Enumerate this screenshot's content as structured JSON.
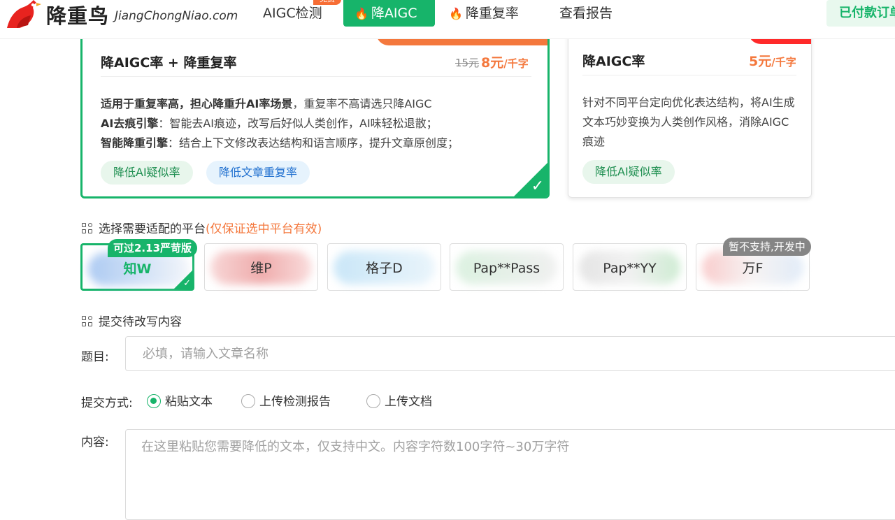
{
  "brand": {
    "name_cn": "降重鸟",
    "name_en": "JiangChongNiao.com"
  },
  "nav": {
    "aigc_detect": "AIGC检测",
    "free_badge": "免费",
    "reduce_aigc": "降AIGC",
    "reduce_dup": "降重复率",
    "view_report": "查看报告",
    "paid_order": "已付款订单"
  },
  "icons": {
    "flame": "🔥",
    "check": "✓"
  },
  "colors": {
    "accent": "#17b46a",
    "price_orange": "#f4783d",
    "ribbon_red": "#ff2a2a"
  },
  "products": [
    {
      "title": "降AIGC率 + 降重复率",
      "price_old": "15元",
      "price_new": "8元",
      "price_unit": "/千字",
      "lines": [
        {
          "bold": "适用于重复率高，担心降重升AI率场景",
          "text": "，重复率不高请选只降AIGC"
        },
        {
          "bold": "AI去痕引擎",
          "text": "：智能去AI痕迹，改写后好似人类创作，AI味轻松退散；"
        },
        {
          "bold": "智能降重引擎",
          "text": "：结合上下文修改表达结构和语言顺序，提升文章原创度；"
        }
      ],
      "tags": [
        "降低AI疑似率",
        "降低文章重复率"
      ],
      "selected": true
    },
    {
      "title": "降AIGC率",
      "price_new": "5元",
      "price_unit": "/千字",
      "description": "针对不同平台定向优化表达结构，将AI生成文本巧妙变换为人类创作风格，消除AIGC痕迹",
      "tags": [
        "降低AI疑似率"
      ],
      "selected": false
    }
  ],
  "platform_section": {
    "label": "选择需要适配的平台",
    "note": "(仅保证选中平台有效)"
  },
  "platforms": [
    {
      "name": "知W",
      "badge": "可过2.13严苛版",
      "selected": true
    },
    {
      "name": "维P"
    },
    {
      "name": "格子D"
    },
    {
      "name": "Pap**Pass"
    },
    {
      "name": "Pap**YY"
    },
    {
      "name": "万F",
      "badge": "暂不支持,开发中"
    }
  ],
  "submit_section": {
    "label": "提交待改写内容"
  },
  "form": {
    "title_label": "题目:",
    "title_placeholder": "必填，请输入文章名称",
    "title_value": "",
    "method_label": "提交方式:",
    "methods": [
      "粘贴文本",
      "上传检测报告",
      "上传文档"
    ],
    "method_selected": "粘贴文本",
    "content_label": "内容:",
    "content_placeholder": "在这里粘贴您需要降低的文本，仅支持中文。内容字符数100字符~30万字符",
    "content_value": ""
  }
}
